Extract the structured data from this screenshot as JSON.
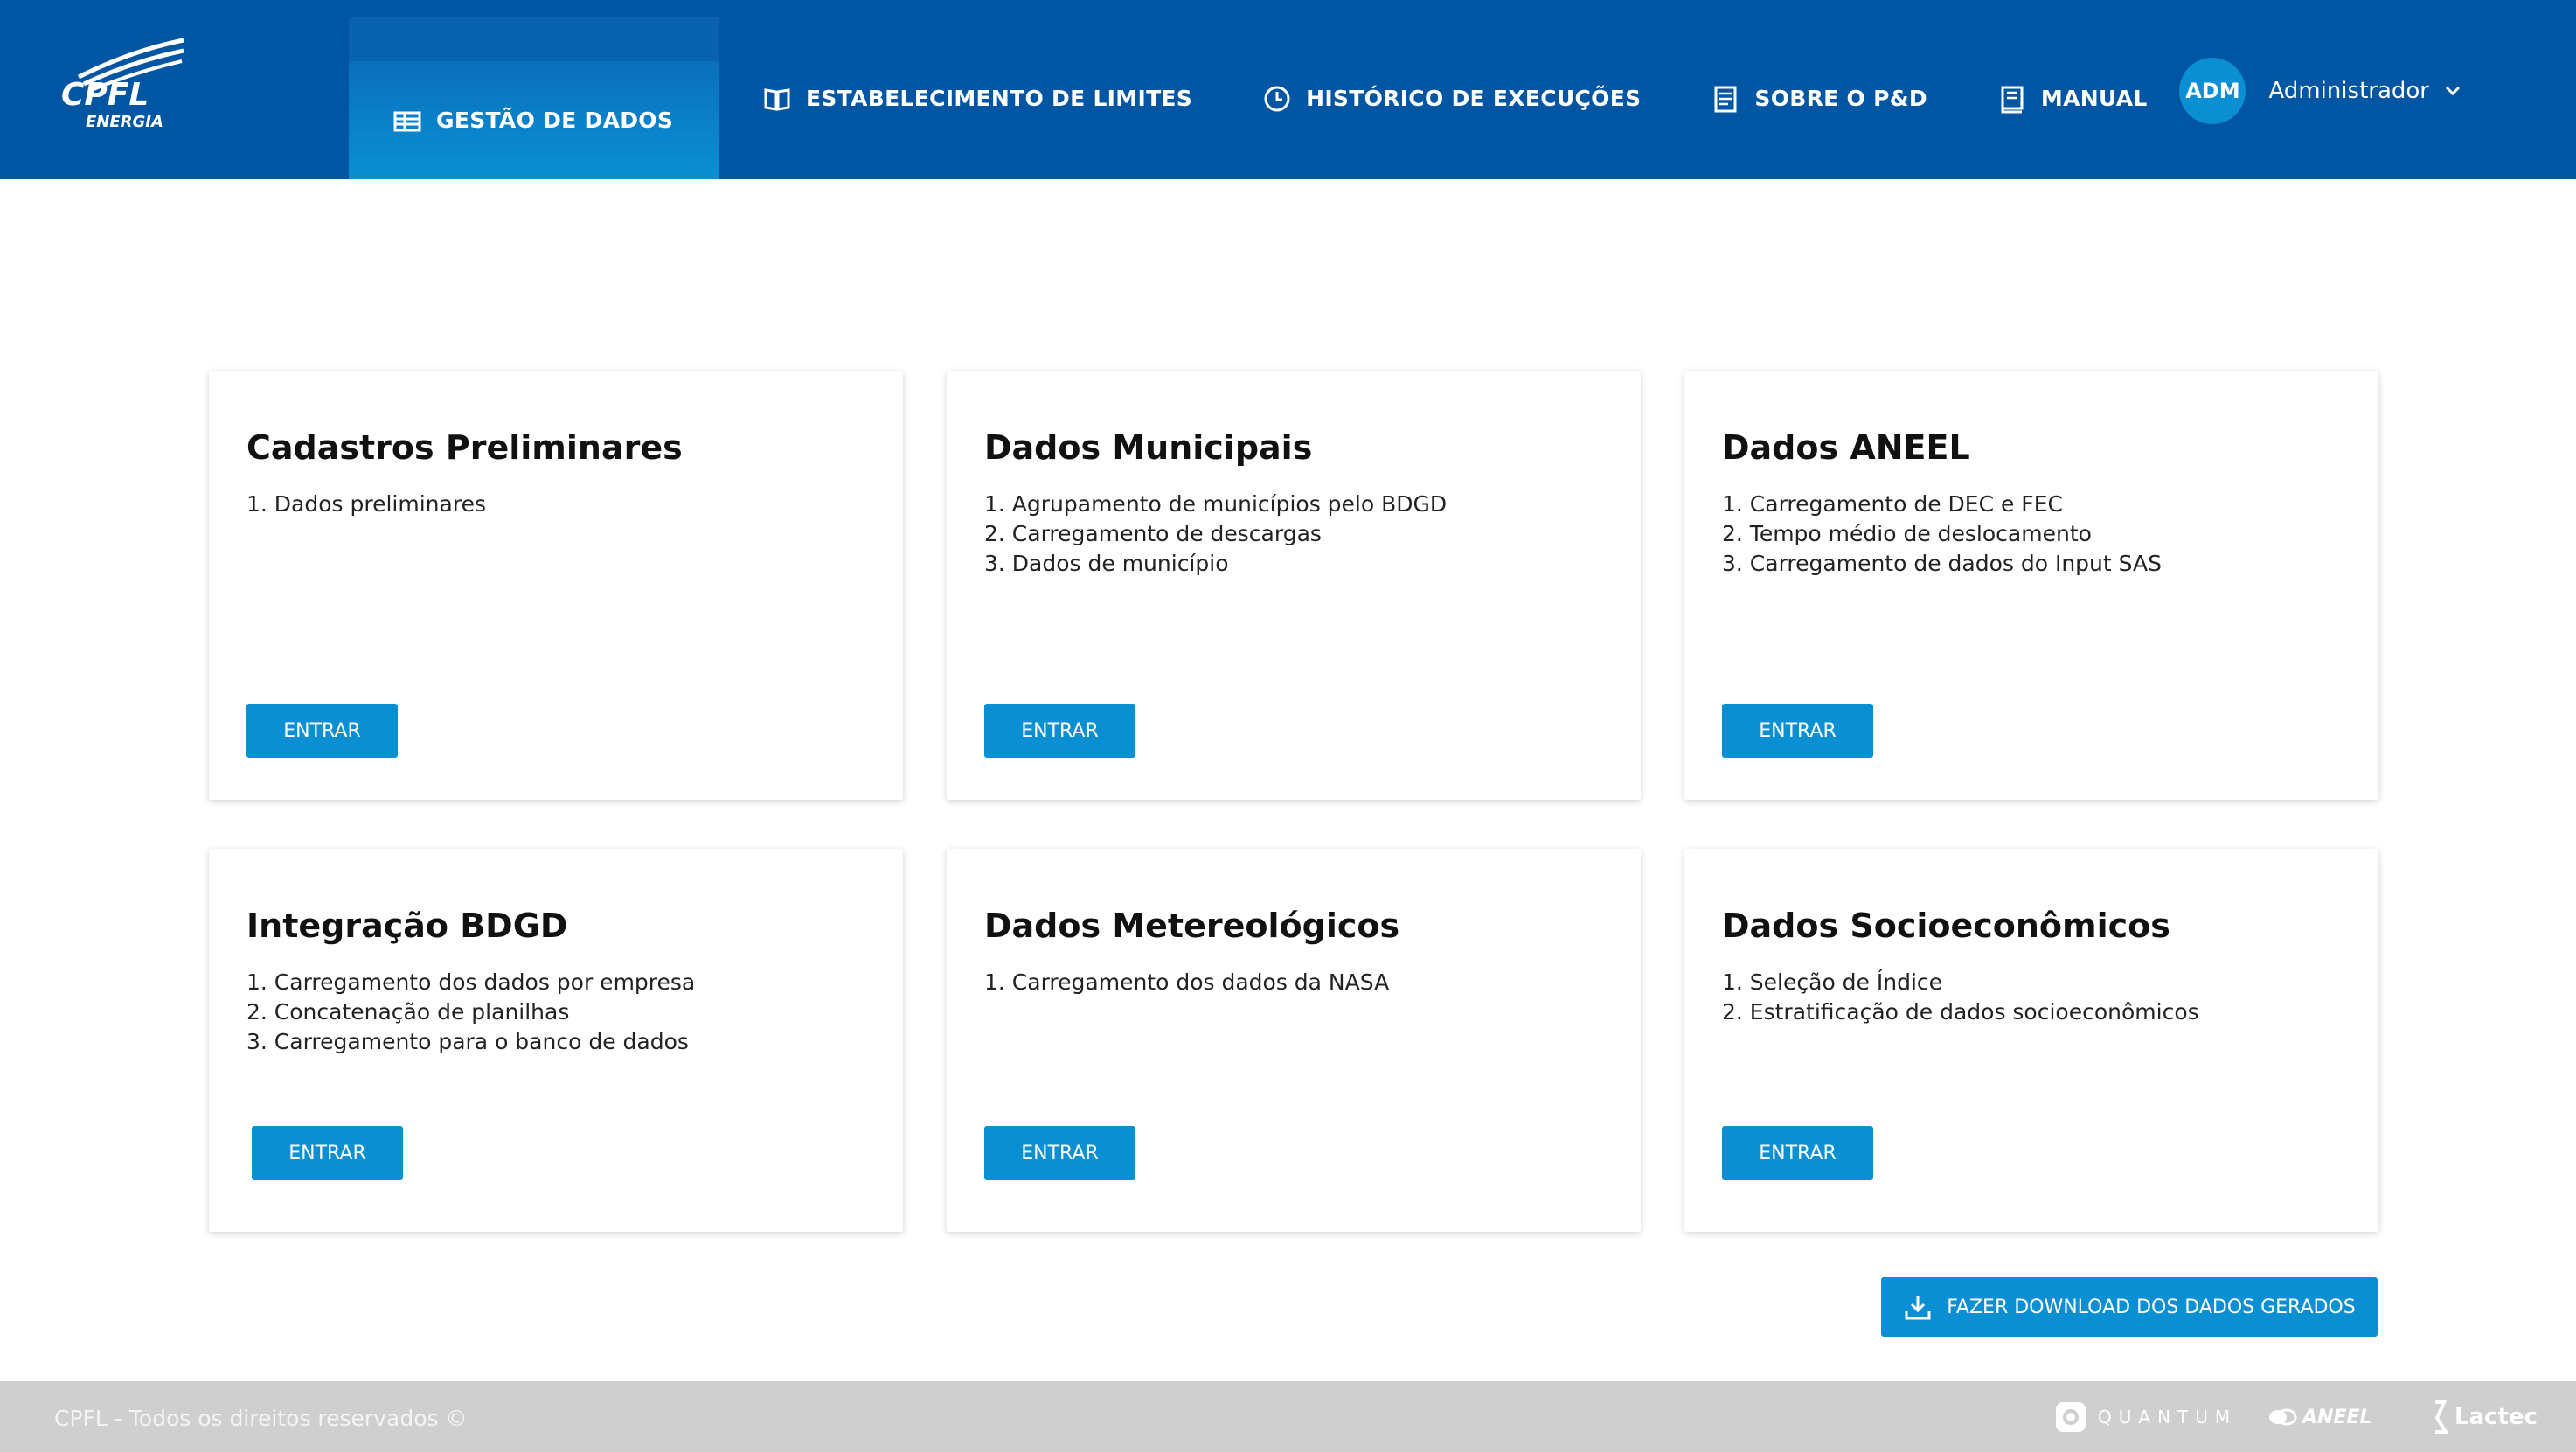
{
  "brand": {
    "logo_name": "CPFL",
    "logo_sub": "ENERGIA",
    "primary_color": "#0056a2",
    "accent_color": "#0a8fd3",
    "footer_color": "#cfcfcf"
  },
  "nav": [
    {
      "label": "GESTÃO DE DADOS",
      "icon": "data-table-icon",
      "active": true
    },
    {
      "label": "ESTABELECIMENTO DE LIMITES",
      "icon": "book-icon",
      "active": false
    },
    {
      "label": "HISTÓRICO DE EXECUÇÕES",
      "icon": "clock-icon",
      "active": false
    },
    {
      "label": "SOBRE O P&D",
      "icon": "document-icon",
      "active": false
    },
    {
      "label": "MANUAL",
      "icon": "manual-icon",
      "active": false
    }
  ],
  "user": {
    "initials": "ADM",
    "name": "Administrador"
  },
  "cards": [
    {
      "title": "Cadastros Preliminares",
      "items": [
        "1. Dados preliminares"
      ],
      "button": "ENTRAR"
    },
    {
      "title": "Dados Municipais",
      "items": [
        "1. Agrupamento de municípios pelo BDGD",
        "2. Carregamento de descargas",
        "3. Dados de município"
      ],
      "button": "ENTRAR"
    },
    {
      "title": "Dados ANEEL",
      "items": [
        "1. Carregamento de DEC e FEC",
        "2. Tempo médio de deslocamento",
        "3. Carregamento de dados do Input SAS"
      ],
      "button": "ENTRAR"
    },
    {
      "title": "Integração BDGD",
      "items": [
        "1. Carregamento dos dados por empresa",
        "2. Concatenação de planilhas",
        "3. Carregamento para o banco de dados"
      ],
      "button": "ENTRAR"
    },
    {
      "title": "Dados Metereológicos",
      "items": [
        "1. Carregamento dos dados da NASA"
      ],
      "button": "ENTRAR"
    },
    {
      "title": "Dados Socioeconômicos",
      "items": [
        "1. Seleção de Índice",
        "2. Estratificação de dados socioeconômicos"
      ],
      "button": "ENTRAR"
    }
  ],
  "download_button": "FAZER DOWNLOAD DOS DADOS GERADOS",
  "footer": {
    "copyright": "CPFL - Todos os direitos reservados ©",
    "partners": [
      "QUANTUM",
      "ANEEL",
      "Lactec"
    ]
  }
}
